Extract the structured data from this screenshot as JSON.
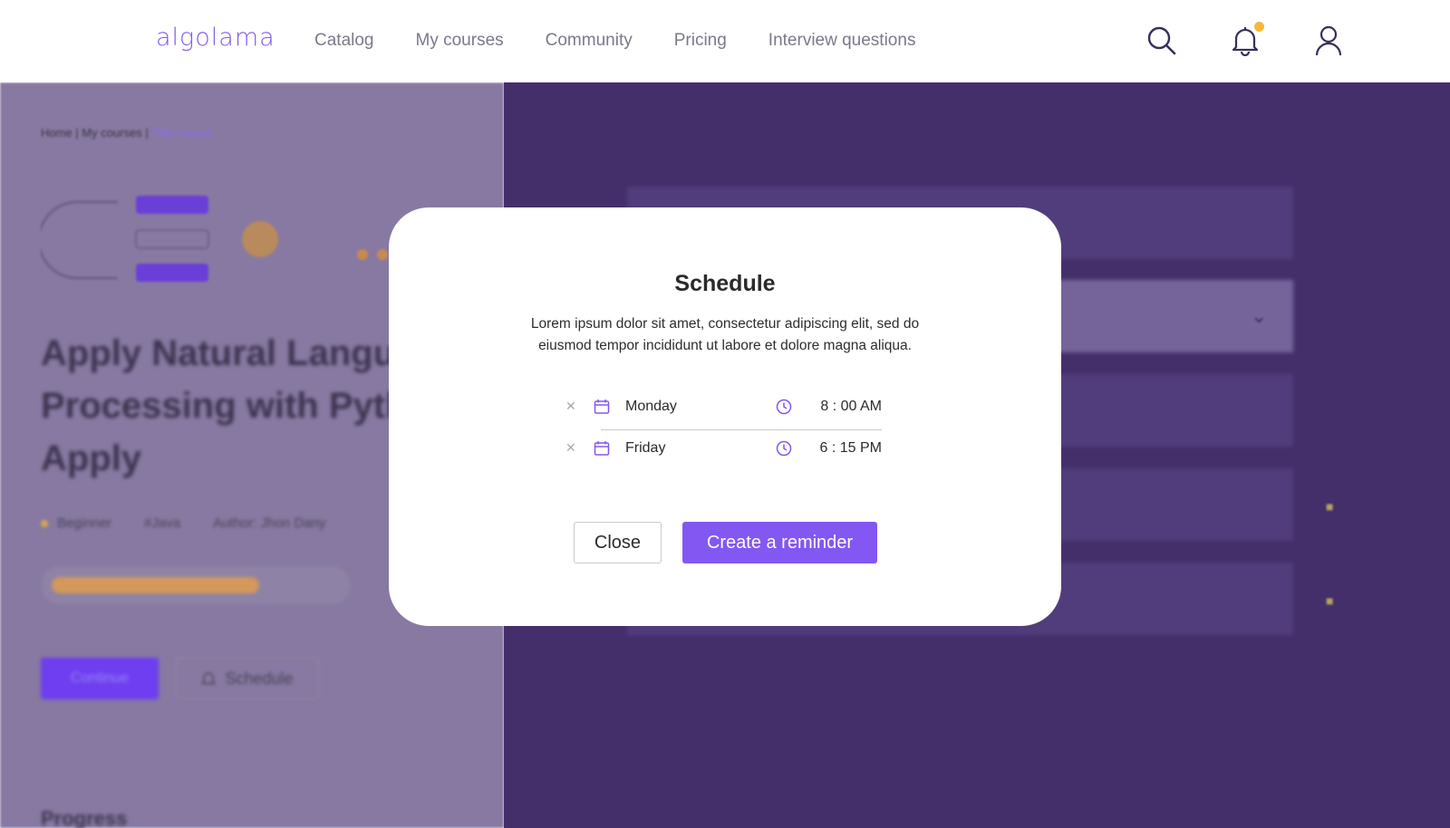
{
  "header": {
    "logo": "algolama",
    "nav": [
      "Catalog",
      "My courses",
      "Community",
      "Pricing",
      "Interview questions"
    ],
    "icons": [
      "search-icon",
      "bell-icon",
      "user-icon"
    ],
    "notification_badge_color": "#f5b93a"
  },
  "background_page": {
    "breadcrumb": [
      "Home",
      "My courses",
      "This course"
    ],
    "course_title": "Apply Natural Language Processing with Python Apply",
    "meta": [
      "Beginner",
      "#Java",
      "Author: Jhon Dany"
    ],
    "progress": 0.72,
    "continue_label": "Continue",
    "schedule_label": "Schedule",
    "progress_heading": "Progress"
  },
  "modal": {
    "title": "Schedule",
    "description": "Lorem ipsum dolor sit amet, consectetur adipiscing elit, sed do eiusmod tempor incididunt ut labore et dolore magna aliqua.",
    "schedules": [
      {
        "day": "Monday",
        "time": "8 : 00 AM"
      },
      {
        "day": "Friday",
        "time": "6 : 15 PM"
      }
    ],
    "close_label": "Close",
    "create_label": "Create a reminder"
  },
  "colors": {
    "accent": "#8357f2",
    "overlay_left": "#8779a1",
    "overlay_right": "#452f6b",
    "progress_fill": "#d4985a"
  }
}
